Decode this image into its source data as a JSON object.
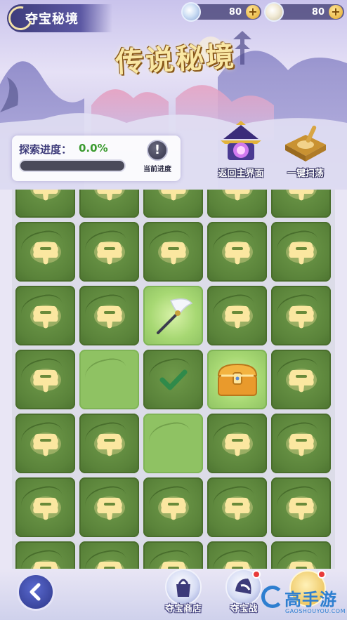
{
  "header": {
    "title": "夺宝秘境",
    "currencies": [
      {
        "icon": "silver-orb-icon",
        "amount": "80"
      },
      {
        "icon": "pearl-shell-icon",
        "amount": "80"
      }
    ],
    "banner_title": "传说秘境"
  },
  "progress": {
    "label": "探索进度：",
    "value": "0.0%",
    "fraction": 0.0,
    "current_label": "当前进度"
  },
  "actions": [
    {
      "label": "返回主界面",
      "icon": "pagoda-portal-icon"
    },
    {
      "label": "一键扫荡",
      "icon": "treasure-tray-icon"
    }
  ],
  "board": {
    "columns": 5,
    "rows": [
      [
        "locked",
        "locked",
        "locked",
        "locked",
        "locked"
      ],
      [
        "locked",
        "locked",
        "locked",
        "locked",
        "locked"
      ],
      [
        "locked",
        "locked",
        "whisk",
        "locked",
        "locked"
      ],
      [
        "locked",
        "cleared",
        "checked",
        "chest",
        "locked"
      ],
      [
        "locked",
        "locked",
        "cleared",
        "locked",
        "locked"
      ],
      [
        "locked",
        "locked",
        "locked",
        "locked",
        "locked"
      ],
      [
        "locked",
        "locked",
        "locked",
        "locked",
        "locked"
      ]
    ],
    "colors": {
      "locked": "#5a833a",
      "cleared": "#8fc263",
      "lock_glyph": "#fbe7a0",
      "check": "#2f8a4a"
    }
  },
  "bottom_nav": {
    "back_icon": "back-arrow-icon",
    "items": [
      {
        "label": "夺宝商店",
        "icon": "shop-bag-icon",
        "badge": false
      },
      {
        "label": "夺宝战",
        "icon": "battle-helmet-icon",
        "badge": true
      }
    ]
  },
  "watermark": {
    "text": "高手游",
    "sub": "GAOSHOUYOU.COM"
  }
}
